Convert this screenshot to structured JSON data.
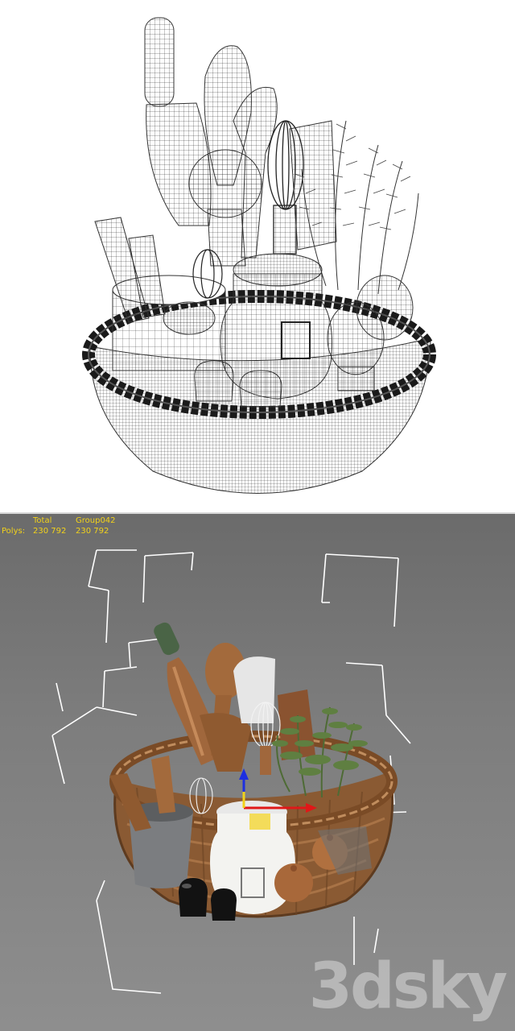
{
  "viewport": {
    "stats": {
      "header_total": "Total",
      "header_group": "Group042",
      "polys_label": "Polys:",
      "polys_total": "230 792",
      "polys_group": "230 792"
    },
    "gizmo_colors": {
      "x": "#e01818",
      "y": "#1d2fe0",
      "z": "#f2d21a"
    }
  },
  "watermark": {
    "text": "3dsky"
  },
  "colors": {
    "wire_line": "#222222",
    "viewport_bg": "#7a7a7a",
    "stats_text": "#f2d21a",
    "basket": "#8a5a33",
    "wood": "#a0673c",
    "herb": "#4e6b35"
  }
}
